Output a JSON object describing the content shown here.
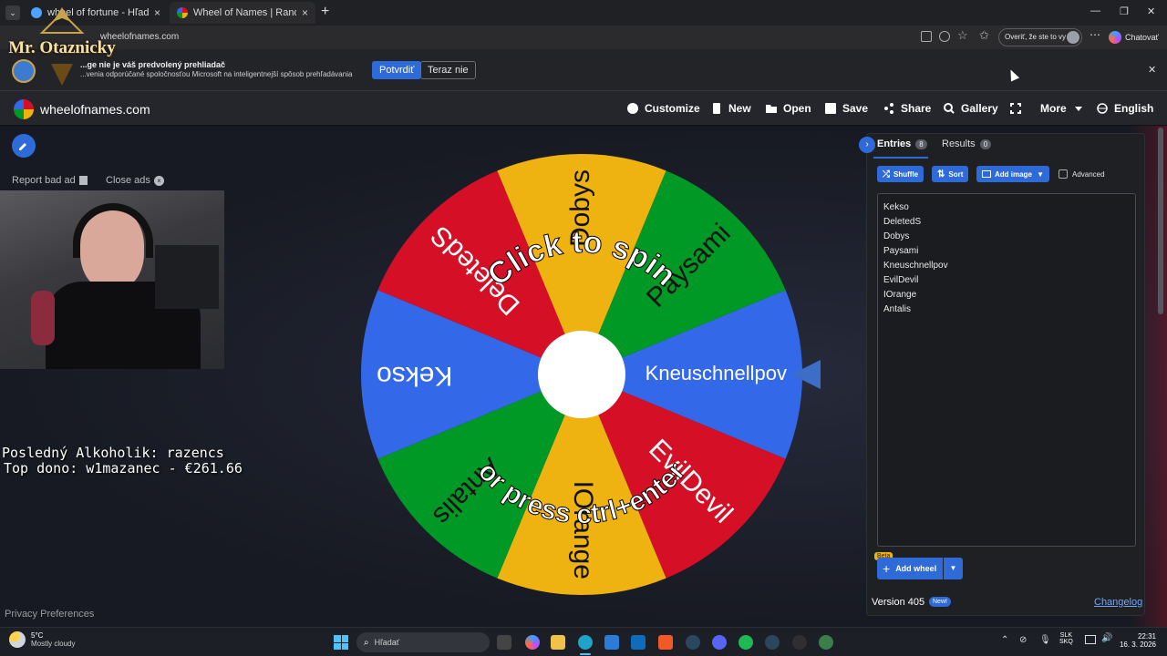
{
  "browser": {
    "tabs": [
      {
        "label": "wheel of fortune - Hľadať",
        "close": "×"
      },
      {
        "label": "Wheel of Names | Random name p",
        "close": "×"
      }
    ],
    "new_tab": "+",
    "address": "wheelofnames.com",
    "verify_label": "Overiť, že ste to vy",
    "copilot_label": "Chatovať",
    "window_controls": [
      "—",
      "❐",
      "✕"
    ]
  },
  "infobar": {
    "title": "...ge nie je váš predvolený prehliadač",
    "text": "...venia odporúčané spoločnosťou Microsoft na inteligentnejší spôsob prehľadávania",
    "confirm": "Potvrdiť",
    "not_now": "Teraz nie",
    "close": "✕"
  },
  "overlay": {
    "logo_text": "Mr. Otaznicky",
    "alcoholic": "Posledný Alkoholik: razencs",
    "top_dono": "Top dono: w1mazanec - €261.66"
  },
  "site": {
    "name": "wheelofnames.com",
    "nav": [
      {
        "label": "Customize",
        "icon": "palette-icon"
      },
      {
        "label": "New",
        "icon": "file-icon"
      },
      {
        "label": "Open",
        "icon": "folder-icon"
      },
      {
        "label": "Save",
        "icon": "save-icon"
      },
      {
        "label": "Share",
        "icon": "share-icon"
      },
      {
        "label": "Gallery",
        "icon": "search-icon"
      },
      {
        "label": "",
        "icon": "fullscreen-icon"
      },
      {
        "label": "More",
        "icon": "caret-down-icon"
      },
      {
        "label": "English",
        "icon": "globe-icon"
      }
    ],
    "report_bad_ad": "Report bad ad",
    "close_ads": "Close ads",
    "privacy": "Privacy Preferences"
  },
  "wheel": {
    "center_text_top": "Click to spin",
    "center_text_bottom": "or press ctrl+enter",
    "segments": [
      {
        "name": "Kneuschnellpov",
        "color": "#3369e8"
      },
      {
        "name": "EvilDevil",
        "color": "#d50f25"
      },
      {
        "name": "IOrange",
        "color": "#eeb211"
      },
      {
        "name": "Antalis",
        "color": "#009925"
      },
      {
        "name": "Kekso",
        "color": "#3369e8"
      },
      {
        "name": "DeletedS",
        "color": "#d50f25"
      },
      {
        "name": "Dobys",
        "color": "#eeb211"
      },
      {
        "name": "Paysami",
        "color": "#009925"
      }
    ]
  },
  "panel": {
    "tabs": [
      {
        "label": "Entries",
        "count": "8"
      },
      {
        "label": "Results",
        "count": "0"
      }
    ],
    "shuffle": "Shuffle",
    "sort": "Sort",
    "add_image": "Add image",
    "advanced": "Advanced",
    "entries": [
      "Kekso",
      "DeletedS",
      "Dobys",
      "Paysami",
      "Kneuschnellpov",
      "EvilDevil",
      "IOrange",
      "Antalis"
    ],
    "beta": "Beta",
    "add_wheel": "Add wheel",
    "version": "Version 405",
    "new_badge": "New!",
    "changelog": "Changelog"
  },
  "taskbar": {
    "temp": "5°C",
    "weather": "Mostly cloudy",
    "search": "Hľadať",
    "lang": "SLK",
    "layout": "SKQ",
    "time": "22:31",
    "date": "16. 3. 2026"
  }
}
